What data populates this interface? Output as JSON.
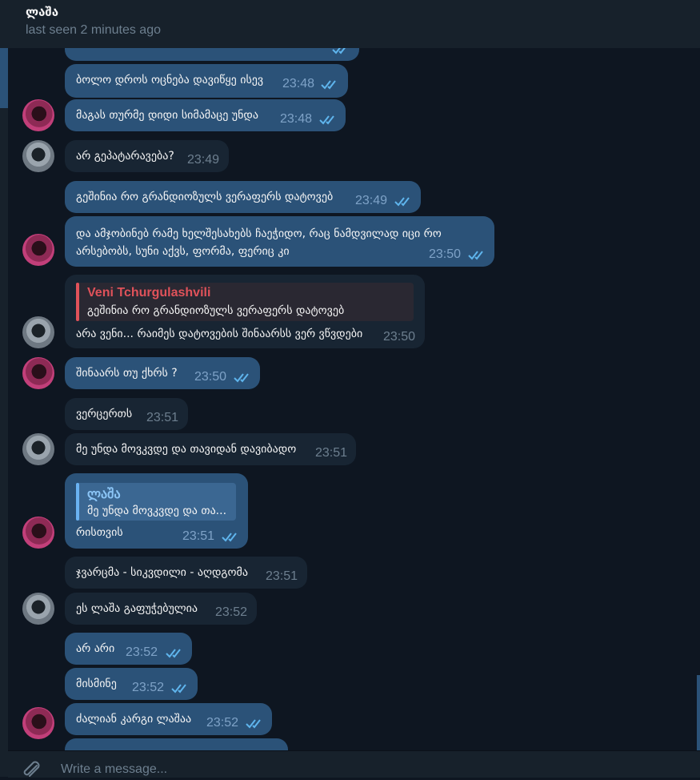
{
  "header": {
    "contact_name": "ლაშა",
    "status": "last seen 2 minutes ago"
  },
  "messages": [
    {
      "dir": "out",
      "text": "ბოლო დროს ოცნება დავიწყე ისევ",
      "time": "23:48",
      "read": true
    },
    {
      "dir": "out",
      "text": "მაგას თურმე დიდი სიმამაცე უნდა",
      "time": "23:48",
      "read": true
    },
    {
      "dir": "in",
      "text": "არ გეპატარავება?",
      "time": "23:49"
    },
    {
      "dir": "out",
      "text": "გეშინია რო გრანდიოზულს ვერაფერს დატოვებ",
      "time": "23:49",
      "read": true
    },
    {
      "dir": "out",
      "text": "და ამჯობინებ რამე ხელშესახებს ჩაეჭიდო, რაც ნამდვილად იცი რო არსებობს, სუნი აქვს, ფორმა, ფერიც კი",
      "time": "23:50",
      "read": true
    },
    {
      "dir": "in",
      "reply_name": "Veni Tchurgulashvili",
      "reply_text": "გეშინია რო გრანდიოზულს ვერაფერს დატოვებ",
      "text": "არა ვენი... რაიმეს დატოვების შინაარსს ვერ ვწვდები",
      "time": "23:50"
    },
    {
      "dir": "out",
      "text": "შინაარს თუ ქხრს ?",
      "time": "23:50",
      "read": true
    },
    {
      "dir": "in",
      "text": "ვერცერთს",
      "time": "23:51"
    },
    {
      "dir": "in",
      "text": "მე უნდა მოვკვდე და თავიდან დავიბადო",
      "time": "23:51"
    },
    {
      "dir": "out",
      "reply_name": "ლაშა",
      "reply_text": "მე უნდა მოვკვდე და თა...",
      "text": "რისთვის",
      "time": "23:51",
      "read": true
    },
    {
      "dir": "in",
      "text": "ჯვარცმა - სიკვდილი - აღდგომა",
      "time": "23:51"
    },
    {
      "dir": "in",
      "text": "ეს ლაშა გაფუჭებულია",
      "time": "23:52"
    },
    {
      "dir": "out",
      "text": "არ არი",
      "time": "23:52",
      "read": true
    },
    {
      "dir": "out",
      "text": "მისმინე",
      "time": "23:52",
      "read": true
    },
    {
      "dir": "out",
      "text": "ძალიან კარგი ლაშაა",
      "time": "23:52",
      "read": true
    }
  ],
  "input": {
    "placeholder": "Write a message..."
  },
  "icons": {
    "attach": "paperclip-icon",
    "read_receipt": "double-check-icon"
  },
  "colors": {
    "background": "#0e1621",
    "header": "#17212b",
    "outgoing_bubble": "#2b5278",
    "incoming_bubble": "#182533",
    "read_check": "#5fb5ed",
    "reply_red": "#e0525a",
    "reply_blue": "#6ab3f3"
  }
}
